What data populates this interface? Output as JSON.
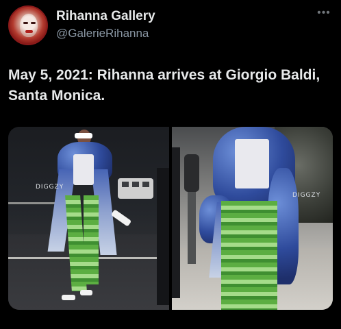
{
  "post": {
    "display_name": "Rihanna Gallery",
    "handle": "@GalerieRihanna",
    "more_icon": "more-horizontal-icon",
    "text": "May 5, 2021: Rihanna arrives at Giorgio Baldi, Santa Monica."
  },
  "media": {
    "left_watermark": "DIGGZY",
    "right_watermark": "DIGGZY"
  }
}
